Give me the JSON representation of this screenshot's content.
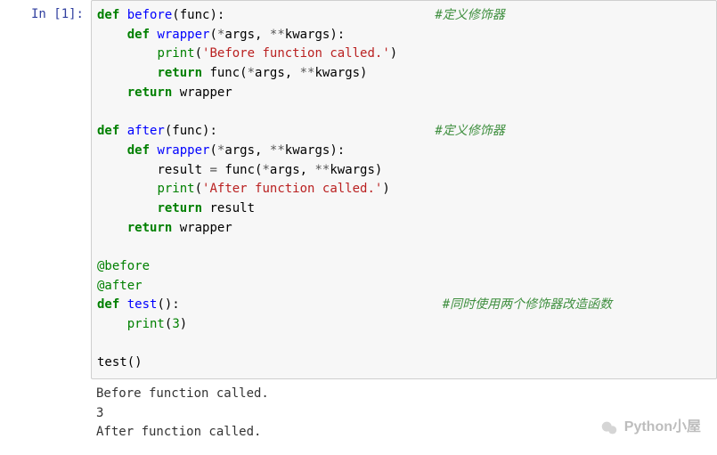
{
  "prompt": "In [1]:",
  "code": {
    "l1": {
      "kw": "def ",
      "fn": "before",
      "p1": "(func):",
      "pad": "                            ",
      "cmt": "#定义修饰器"
    },
    "l2": {
      "ind": "    ",
      "kw": "def ",
      "fn": "wrapper",
      "p": "(",
      "s1": "*",
      "a1": "args, ",
      "s2": "**",
      "a2": "kwargs):"
    },
    "l3": {
      "ind": "        ",
      "bi": "print",
      "p1": "(",
      "str": "'Before function called.'",
      "p2": ")"
    },
    "l4": {
      "ind": "        ",
      "kw": "return ",
      "id": "func(",
      "s1": "*",
      "a1": "args, ",
      "s2": "**",
      "a2": "kwargs)"
    },
    "l5": {
      "ind": "    ",
      "kw": "return ",
      "id": "wrapper"
    },
    "l6": "",
    "l7": {
      "kw": "def ",
      "fn": "after",
      "p1": "(func):",
      "pad": "                             ",
      "cmt": "#定义修饰器"
    },
    "l8": {
      "ind": "    ",
      "kw": "def ",
      "fn": "wrapper",
      "p": "(",
      "s1": "*",
      "a1": "args, ",
      "s2": "**",
      "a2": "kwargs):"
    },
    "l9": {
      "ind": "        ",
      "id1": "result ",
      "op": "= ",
      "id2": "func(",
      "s1": "*",
      "a1": "args, ",
      "s2": "**",
      "a2": "kwargs)"
    },
    "l10": {
      "ind": "        ",
      "bi": "print",
      "p1": "(",
      "str": "'After function called.'",
      "p2": ")"
    },
    "l11": {
      "ind": "        ",
      "kw": "return ",
      "id": "result"
    },
    "l12": {
      "ind": "    ",
      "kw": "return ",
      "id": "wrapper"
    },
    "l13": "",
    "l14": "@before",
    "l15": "@after",
    "l16": {
      "kw": "def ",
      "fn": "test",
      "p1": "():",
      "pad": "                                   ",
      "cmt": "#同时使用两个修饰器改造函数"
    },
    "l17": {
      "ind": "    ",
      "bi": "print",
      "p1": "(",
      "num": "3",
      "p2": ")"
    },
    "l18": "",
    "l19": "test()"
  },
  "output": {
    "l1": "Before function called.",
    "l2": "3",
    "l3": "After function called."
  },
  "watermark": "Python小屋"
}
